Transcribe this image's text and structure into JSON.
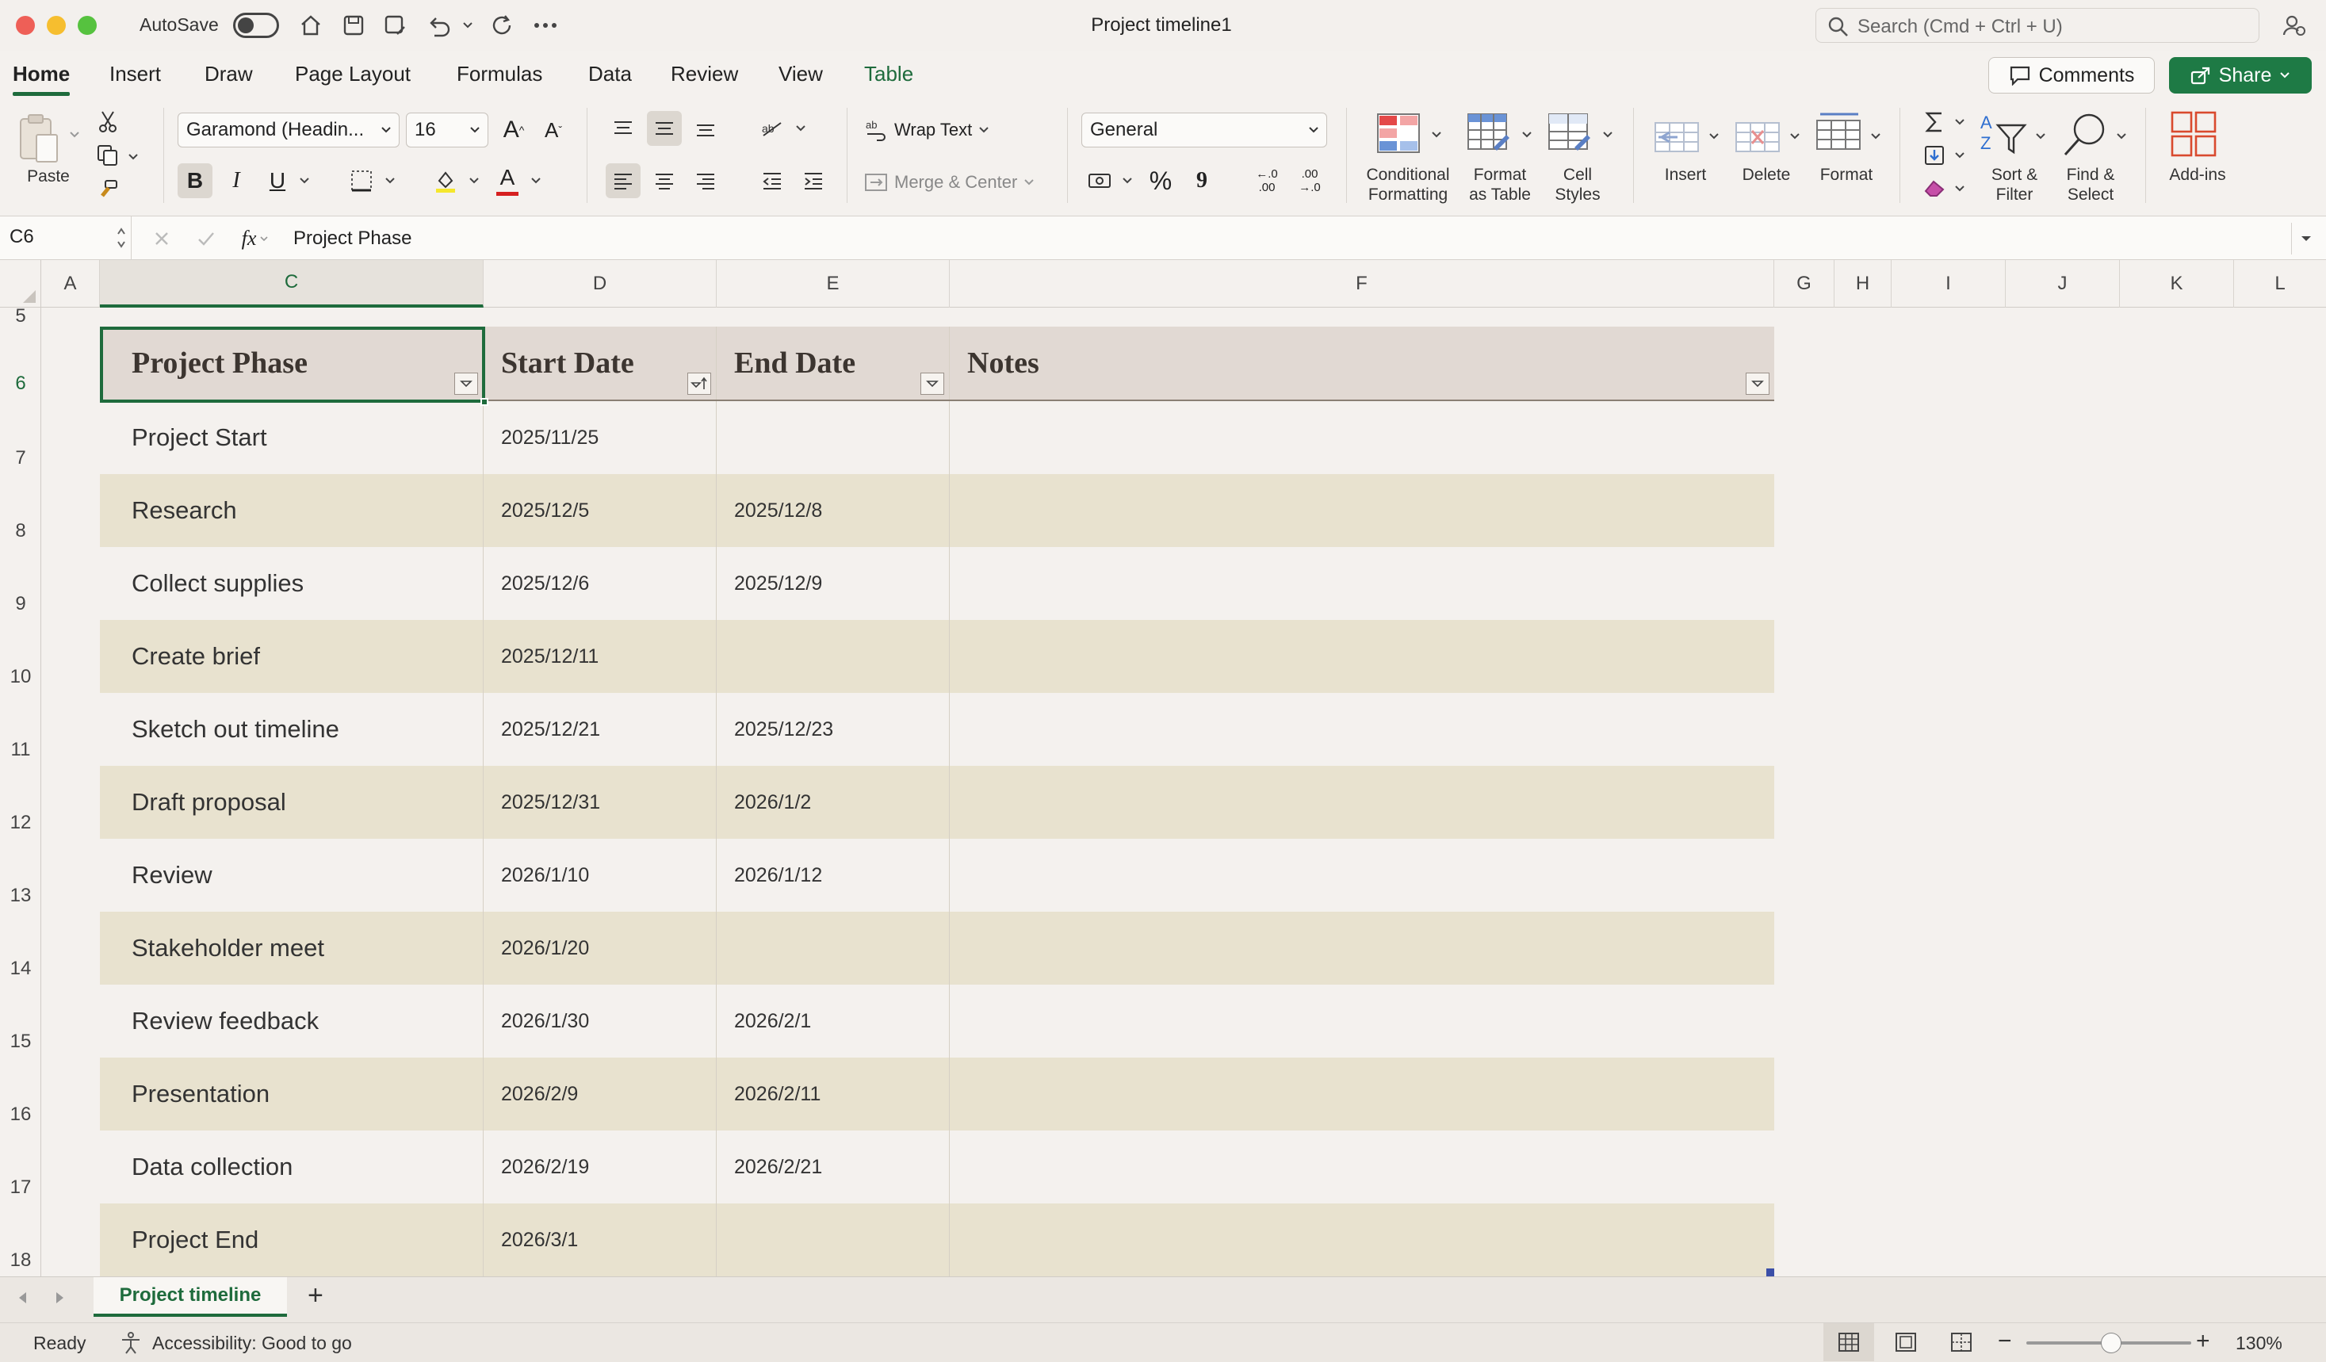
{
  "titlebar": {
    "autosave_label": "AutoSave",
    "doc_title": "Project timeline1",
    "search_placeholder": "Search (Cmd + Ctrl + U)"
  },
  "menu": {
    "tabs": [
      "Home",
      "Insert",
      "Draw",
      "Page Layout",
      "Formulas",
      "Data",
      "Review",
      "View",
      "Table"
    ],
    "active": "Home",
    "comments_label": "Comments",
    "share_label": "Share"
  },
  "ribbon": {
    "paste_label": "Paste",
    "font_name": "Garamond (Headin...",
    "font_size": "16",
    "wrap_text": "Wrap Text",
    "merge_center": "Merge & Center",
    "number_format": "General",
    "conditional_formatting": [
      "Conditional",
      "Formatting"
    ],
    "format_as_table": [
      "Format",
      "as Table"
    ],
    "cell_styles": [
      "Cell",
      "Styles"
    ],
    "insert": "Insert",
    "delete": "Delete",
    "format": "Format",
    "sort_filter": [
      "Sort &",
      "Filter"
    ],
    "find_select": [
      "Find &",
      "Select"
    ],
    "addins": "Add-ins",
    "bold": "B",
    "italic": "I",
    "underline": "U",
    "percent": "%",
    "comma": "9",
    "inc_decimal_a": "←.0",
    "inc_decimal_b": ".00",
    "dec_decimal_a": ".00",
    "dec_decimal_b": "→.0",
    "font_grow": "A",
    "font_shrink": "A",
    "font_color_glyph": "A"
  },
  "formula_bar": {
    "name_box": "C6",
    "fx": "fx",
    "content": "Project Phase"
  },
  "columns": [
    "A",
    "C",
    "D",
    "E",
    "F",
    "G",
    "H",
    "I",
    "J",
    "K",
    "L"
  ],
  "rows": [
    "5",
    "6",
    "7",
    "8",
    "9",
    "10",
    "11",
    "12",
    "13",
    "14",
    "15",
    "16",
    "17",
    "18"
  ],
  "table": {
    "headers": [
      "Project Phase",
      "Start Date",
      "End Date",
      "Notes"
    ],
    "rows": [
      {
        "phase": "Project Start",
        "start": "2025/11/25",
        "end": "",
        "notes": ""
      },
      {
        "phase": "Research",
        "start": "2025/12/5",
        "end": "2025/12/8",
        "notes": ""
      },
      {
        "phase": "Collect supplies",
        "start": "2025/12/6",
        "end": "2025/12/9",
        "notes": ""
      },
      {
        "phase": "Create brief",
        "start": "2025/12/11",
        "end": "",
        "notes": ""
      },
      {
        "phase": "Sketch out timeline",
        "start": "2025/12/21",
        "end": "2025/12/23",
        "notes": ""
      },
      {
        "phase": "Draft proposal",
        "start": "2025/12/31",
        "end": "2026/1/2",
        "notes": ""
      },
      {
        "phase": "Review",
        "start": "2026/1/10",
        "end": "2026/1/12",
        "notes": ""
      },
      {
        "phase": "Stakeholder meet",
        "start": "2026/1/20",
        "end": "",
        "notes": ""
      },
      {
        "phase": "Review feedback",
        "start": "2026/1/30",
        "end": "2026/2/1",
        "notes": ""
      },
      {
        "phase": "Presentation",
        "start": "2026/2/9",
        "end": "2026/2/11",
        "notes": ""
      },
      {
        "phase": "Data collection",
        "start": "2026/2/19",
        "end": "2026/2/21",
        "notes": ""
      },
      {
        "phase": "Project End",
        "start": "2026/3/1",
        "end": "",
        "notes": ""
      }
    ]
  },
  "sheets": {
    "tabs": [
      "Project timeline"
    ],
    "add": "+"
  },
  "status": {
    "ready": "Ready",
    "accessibility": "Accessibility: Good to go",
    "zoom": "130%",
    "zoom_minus": "−",
    "zoom_plus": "+"
  },
  "colors": {
    "accent": "#1e6b3c",
    "header_fill": "#e1d9d3",
    "band_fill": "#e8e2cf",
    "share": "#1e7a45"
  }
}
